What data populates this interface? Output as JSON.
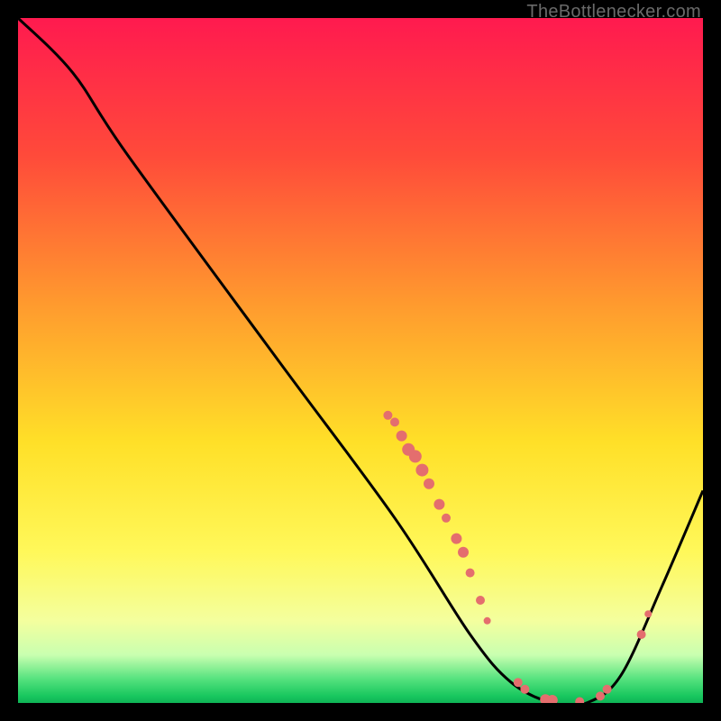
{
  "attribution": "TheBottlenecker.com",
  "chart_data": {
    "type": "line",
    "title": "",
    "xlabel": "",
    "ylabel": "",
    "xlim": [
      0,
      100
    ],
    "ylim": [
      0,
      100
    ],
    "series": [
      {
        "name": "curve",
        "color": "#000000",
        "points": [
          {
            "x": 0,
            "y": 100
          },
          {
            "x": 8,
            "y": 92
          },
          {
            "x": 16,
            "y": 80
          },
          {
            "x": 38,
            "y": 50
          },
          {
            "x": 55,
            "y": 27
          },
          {
            "x": 66,
            "y": 10
          },
          {
            "x": 72,
            "y": 3
          },
          {
            "x": 78,
            "y": 0
          },
          {
            "x": 83,
            "y": 0
          },
          {
            "x": 88,
            "y": 4
          },
          {
            "x": 94,
            "y": 17
          },
          {
            "x": 100,
            "y": 31
          }
        ]
      }
    ],
    "markers": {
      "color": "#e46e6e",
      "points": [
        {
          "x": 54,
          "y": 42,
          "r": 5
        },
        {
          "x": 55,
          "y": 41,
          "r": 5
        },
        {
          "x": 56,
          "y": 39,
          "r": 6
        },
        {
          "x": 57,
          "y": 37,
          "r": 7
        },
        {
          "x": 58,
          "y": 36,
          "r": 7
        },
        {
          "x": 59,
          "y": 34,
          "r": 7
        },
        {
          "x": 60,
          "y": 32,
          "r": 6
        },
        {
          "x": 61.5,
          "y": 29,
          "r": 6
        },
        {
          "x": 62.5,
          "y": 27,
          "r": 5
        },
        {
          "x": 64,
          "y": 24,
          "r": 6
        },
        {
          "x": 65,
          "y": 22,
          "r": 6
        },
        {
          "x": 66,
          "y": 19,
          "r": 5
        },
        {
          "x": 67.5,
          "y": 15,
          "r": 5
        },
        {
          "x": 68.5,
          "y": 12,
          "r": 4
        },
        {
          "x": 73,
          "y": 3,
          "r": 5
        },
        {
          "x": 74,
          "y": 2,
          "r": 5
        },
        {
          "x": 77,
          "y": 0.5,
          "r": 6
        },
        {
          "x": 78,
          "y": 0.4,
          "r": 6
        },
        {
          "x": 82,
          "y": 0.2,
          "r": 5
        },
        {
          "x": 85,
          "y": 1,
          "r": 5
        },
        {
          "x": 86,
          "y": 2,
          "r": 5
        },
        {
          "x": 91,
          "y": 10,
          "r": 5
        },
        {
          "x": 92,
          "y": 13,
          "r": 4
        }
      ]
    },
    "gradient_stops": [
      {
        "offset": 0,
        "color": "#ff1a4f"
      },
      {
        "offset": 0.2,
        "color": "#ff4a3a"
      },
      {
        "offset": 0.42,
        "color": "#ff9b2e"
      },
      {
        "offset": 0.62,
        "color": "#ffe028"
      },
      {
        "offset": 0.78,
        "color": "#fff85a"
      },
      {
        "offset": 0.88,
        "color": "#f4ff9e"
      },
      {
        "offset": 0.93,
        "color": "#c9ffb0"
      },
      {
        "offset": 0.965,
        "color": "#55e27e"
      },
      {
        "offset": 0.99,
        "color": "#18c75e"
      },
      {
        "offset": 1.0,
        "color": "#0fb356"
      }
    ]
  }
}
